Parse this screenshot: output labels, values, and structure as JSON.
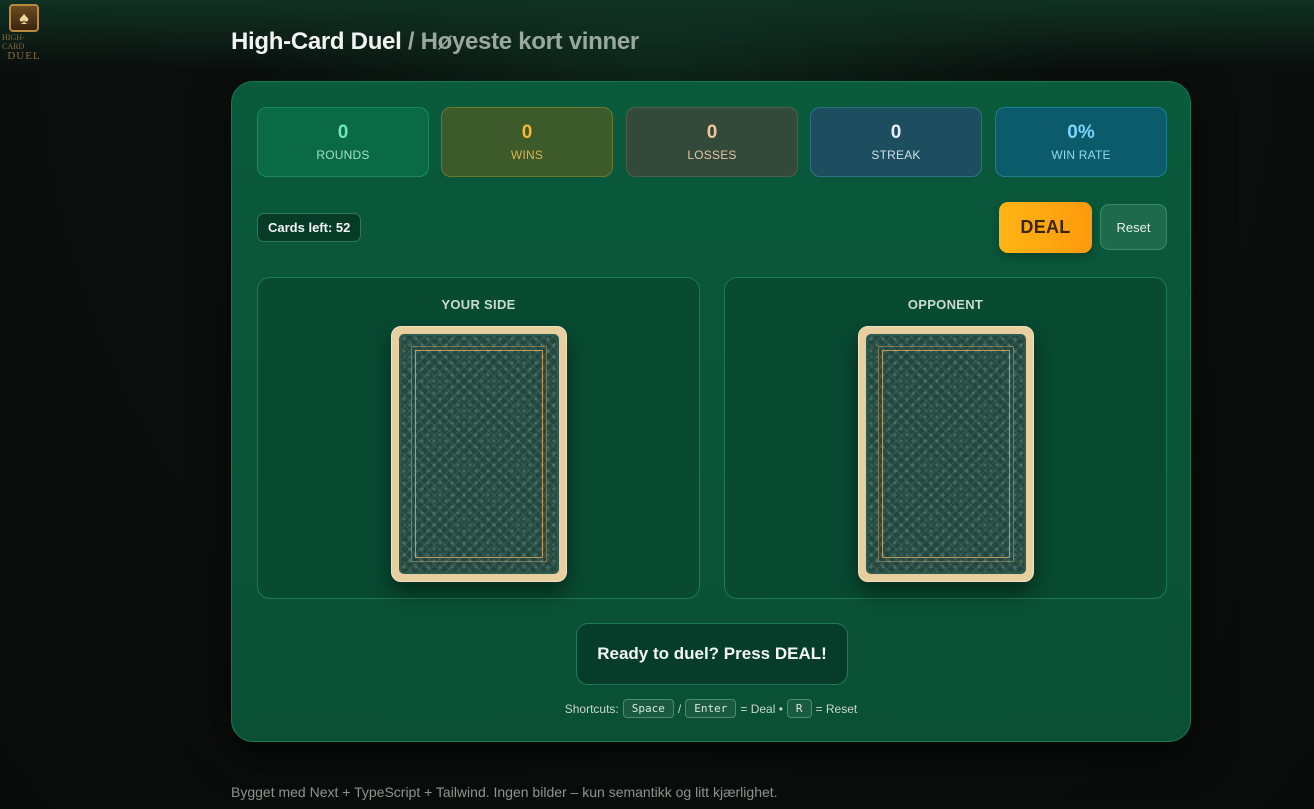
{
  "header": {
    "logo_line1": "HIGH-CARD",
    "logo_line2": "DUEL",
    "title_main": "High-Card Duel",
    "title_sub": " / Høyeste kort vinner"
  },
  "stats": [
    {
      "value": "0",
      "label": "ROUNDS"
    },
    {
      "value": "0",
      "label": "WINS"
    },
    {
      "value": "0",
      "label": "LOSSES"
    },
    {
      "value": "0",
      "label": "STREAK"
    },
    {
      "value": "0%",
      "label": "WIN RATE"
    }
  ],
  "controls": {
    "cards_left": "Cards left: 52",
    "deal_label": "DEAL",
    "reset_label": "Reset"
  },
  "table": {
    "you_title": "YOUR SIDE",
    "opp_title": "OPPONENT"
  },
  "status_message": "Ready to duel? Press DEAL!",
  "shortcuts": {
    "prefix": "Shortcuts:",
    "key_space": "Space",
    "sep": "/",
    "key_enter": "Enter",
    "deal_text": "= Deal •",
    "key_r": "R",
    "reset_text": "= Reset"
  },
  "footer": "Bygget med Next + TypeScript + Tailwind. Ingen bilder – kun semantikk og litt kjærlighet.",
  "colors": {
    "accent": "#ffb415",
    "felt": "#0a5a3c",
    "card_edge": "#e7cfa0"
  }
}
